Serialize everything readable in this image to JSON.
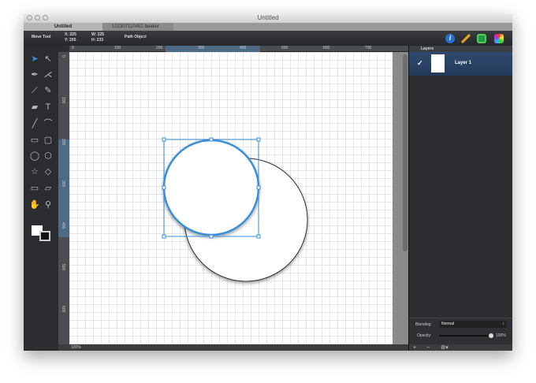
{
  "window": {
    "title": "Untitled"
  },
  "tabs": [
    {
      "label": "Untitled",
      "active": true
    },
    {
      "label": "102307110452-beaker",
      "active": false
    }
  ],
  "toolbar": {
    "tool_name": "Move Tool",
    "x": "X: 225",
    "y": "Y: 205",
    "w": "W: 225",
    "h": "H: 233",
    "object_type": "Path Object"
  },
  "ruler": {
    "h_ticks": [
      "0",
      "100",
      "200",
      "300",
      "400",
      "500",
      "600",
      "700"
    ],
    "v_ticks": [
      "0",
      "100",
      "200",
      "300",
      "400",
      "500",
      "600"
    ]
  },
  "status": {
    "zoom": "100%"
  },
  "layers": {
    "title": "Layers",
    "items": [
      {
        "name": "Layer 1",
        "visible": true,
        "selected": true
      }
    ],
    "blending_label": "Blending:",
    "blending_value": "Normal",
    "opacity_label": "Opacity:",
    "opacity_value": "100%",
    "opacity": 1.0
  },
  "colors": {
    "accent": "#3a8fd8",
    "panel_selected": "#2f4a70"
  }
}
